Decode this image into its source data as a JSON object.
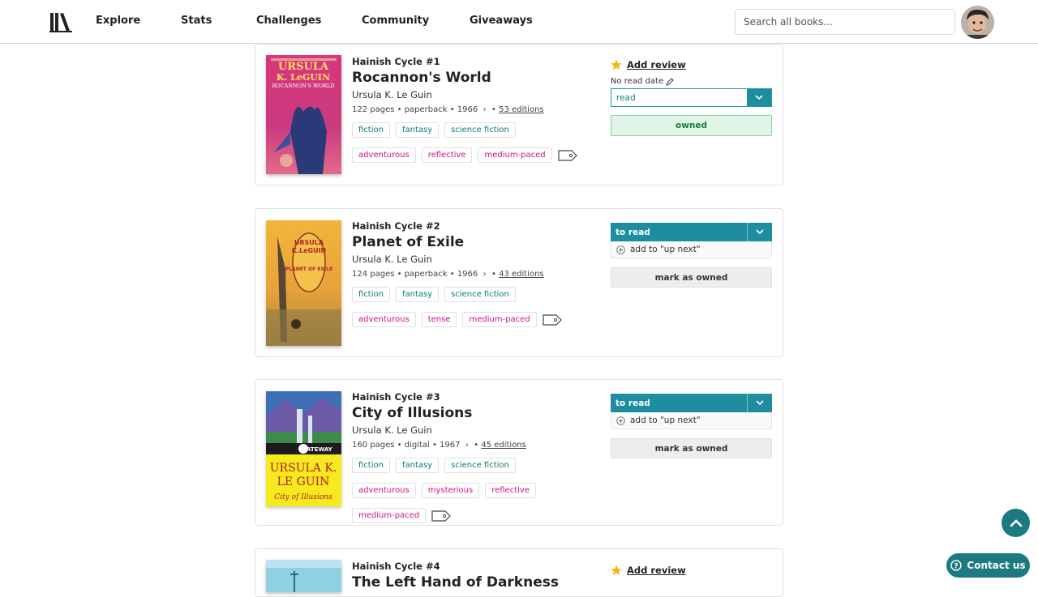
{
  "nav": {
    "links": [
      "Explore",
      "Stats",
      "Challenges",
      "Community",
      "Giveaways"
    ],
    "search_placeholder": "Search all books..."
  },
  "colors": {
    "accent": "#1f8da0",
    "genre_tag": "#0b7a78",
    "mood_tag": "#d1108a",
    "owned_bg": "#dff6e6",
    "star": "#f4b81e"
  },
  "books": [
    {
      "series": "Hainish Cycle #1",
      "title": "Rocannon's World",
      "author": "Ursula K. Le Guin",
      "meta": "122 pages • paperback • 1966",
      "editions": "53 editions",
      "genres": [
        "fiction",
        "fantasy",
        "science fiction"
      ],
      "moods": [
        "adventurous",
        "reflective",
        "medium-paced"
      ],
      "review_label": "Add review",
      "read_date": "No read date",
      "status": "read",
      "owned_label": "owned",
      "cover": {
        "line1": "URSULA",
        "line2": "K. LeGUIN",
        "line3": "ROCANNON'S WORLD"
      }
    },
    {
      "series": "Hainish Cycle #2",
      "title": "Planet of Exile",
      "author": "Ursula K. Le Guin",
      "meta": "124 pages • paperback • 1966",
      "editions": "43 editions",
      "genres": [
        "fiction",
        "fantasy",
        "science fiction"
      ],
      "moods": [
        "adventurous",
        "tense",
        "medium-paced"
      ],
      "status": "to read",
      "upnext_label": "add to \"up next\"",
      "mark_owned_label": "mark as owned",
      "cover": {
        "line1": "URSULA",
        "line2": "K.LeGUIN",
        "line3": "PLANET OF EXILE"
      }
    },
    {
      "series": "Hainish Cycle #3",
      "title": "City of Illusions",
      "author": "Ursula K. Le Guin",
      "meta": "160 pages • digital • 1967",
      "editions": "45 editions",
      "genres": [
        "fiction",
        "fantasy",
        "science fiction"
      ],
      "moods": [
        "adventurous",
        "mysterious",
        "reflective",
        "medium-paced"
      ],
      "status": "to read",
      "upnext_label": "add to \"up next\"",
      "mark_owned_label": "mark as owned",
      "cover": {
        "line1": "URSULA K.",
        "line2": "LE GUIN",
        "line3": "City of Illusions",
        "badge": "GATEWAY"
      }
    },
    {
      "series": "Hainish Cycle #4",
      "title": "The Left Hand of Darkness",
      "review_label": "Add review"
    }
  ],
  "footer": {
    "contact_label": "Contact us"
  }
}
